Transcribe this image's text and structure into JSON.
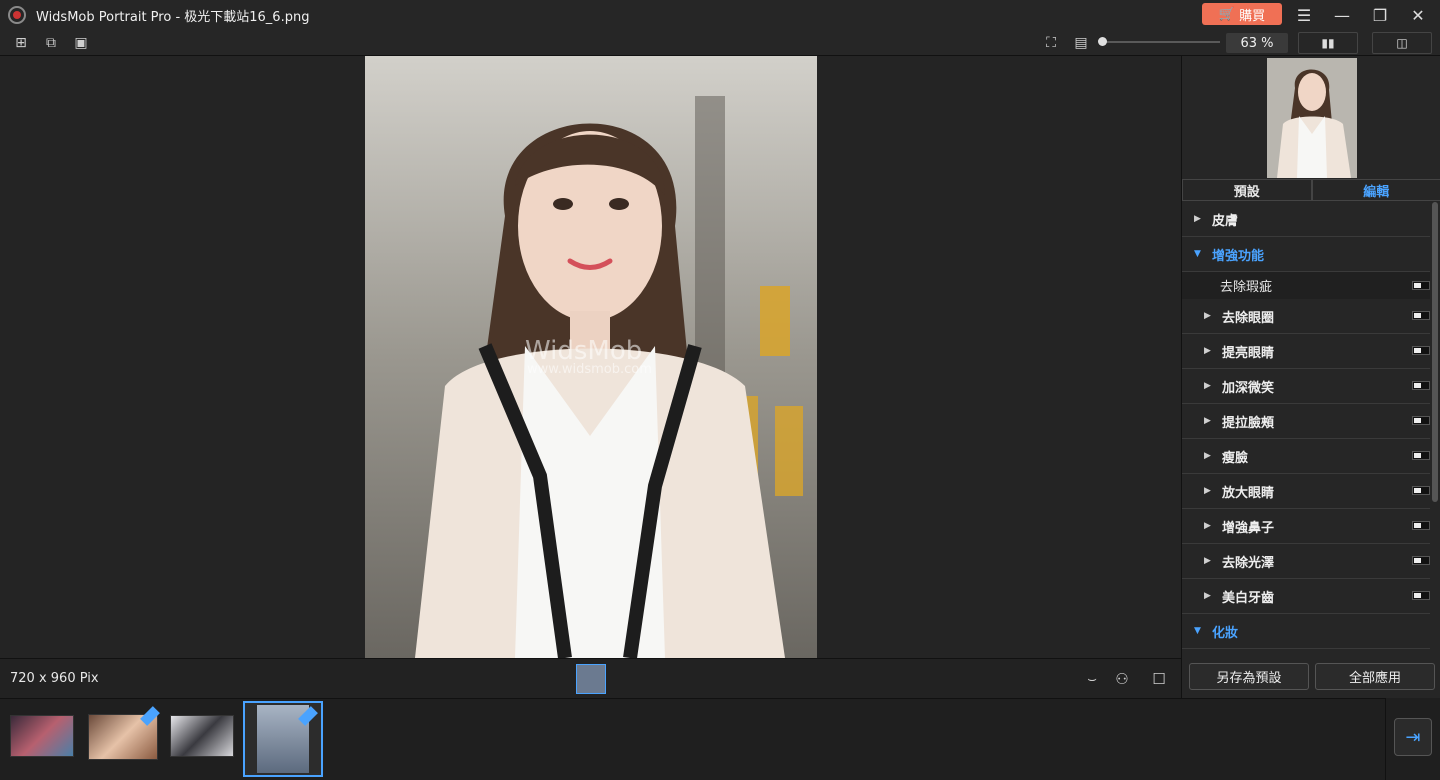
{
  "window": {
    "title": "WidsMob Portrait Pro - 极光下載站16_6.png",
    "buy_label": "購買",
    "buy_color": "#f07055"
  },
  "toolbar": {
    "zoom_value": "63 %",
    "zoom_level": 0.05
  },
  "canvas": {
    "watermark": "WidsMob",
    "watermark_url": "www.widsmob.com"
  },
  "status": {
    "dimensions": "720 x 960 Pix"
  },
  "sidebar": {
    "tabs": [
      {
        "label": "預設"
      },
      {
        "label": "編輯"
      }
    ],
    "active_tab": "編輯",
    "sections": [
      {
        "label": "皮膚",
        "expanded": false
      },
      {
        "label": "增強功能",
        "expanded": true
      },
      {
        "label": "化妝",
        "expanded": true
      }
    ],
    "enhance_items": [
      {
        "label": "去除瑕疵"
      },
      {
        "label": "去除眼圈"
      },
      {
        "label": "提亮眼睛"
      },
      {
        "label": "加深微笑"
      },
      {
        "label": "提拉臉頰"
      },
      {
        "label": "瘦臉"
      },
      {
        "label": "放大眼睛"
      },
      {
        "label": "增強鼻子"
      },
      {
        "label": "去除光澤"
      },
      {
        "label": "美白牙齒"
      }
    ],
    "save_preset_label": "另存為預設",
    "apply_all_label": "全部應用"
  },
  "accent_color": "#4aa3ff"
}
